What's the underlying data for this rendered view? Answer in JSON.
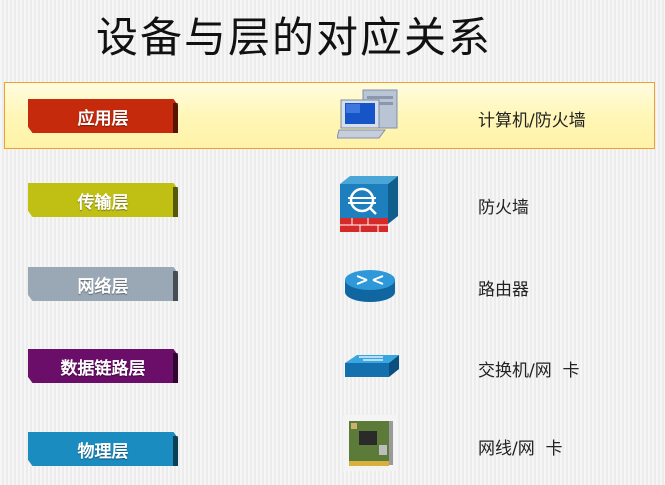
{
  "title": "设备与层的对应关系",
  "rows": [
    {
      "layer": "应用层",
      "device": "计算机/防火墙",
      "layer_color": "#c52a0c",
      "icon": "computer-icon"
    },
    {
      "layer": "传输层",
      "device": "防火墙",
      "layer_color": "#c0c014",
      "icon": "firewall-icon"
    },
    {
      "layer": "网络层",
      "device": "路由器",
      "layer_color": "#9aa8b6",
      "icon": "router-icon"
    },
    {
      "layer": "数据链路层",
      "device": "交换机/网  卡",
      "layer_color": "#6a0e6a",
      "icon": "switch-icon"
    },
    {
      "layer": "物理层",
      "device": "网线/网  卡",
      "layer_color": "#1a8cc0",
      "icon": "network-card-icon"
    }
  ]
}
